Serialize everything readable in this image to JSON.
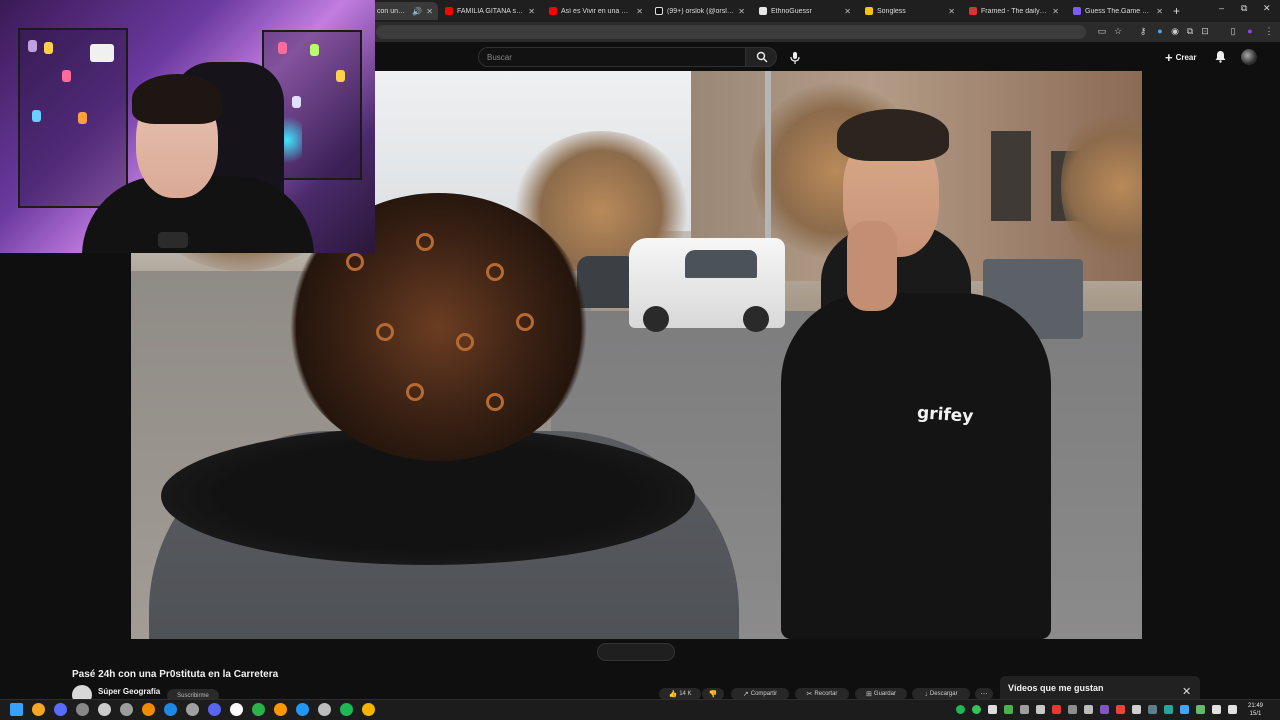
{
  "browser": {
    "tabs": [
      {
        "title": "con una Pr0",
        "color": "#c4302b",
        "active": true,
        "has_audio": true
      },
      {
        "title": "FAMILIA GITANA se enfre",
        "color": "#ff0000",
        "active": false
      },
      {
        "title": "Así es Vivir en una CASA",
        "color": "#ff0000",
        "active": false
      },
      {
        "title": "(99+) orslok (@orslokx) | T",
        "color": "#ffffff",
        "active": false
      },
      {
        "title": "EthnoGuessr",
        "color": "#e6e6e6",
        "active": false
      },
      {
        "title": "Songless",
        "color": "#f5c400",
        "active": false
      },
      {
        "title": "Framed - The daily movie",
        "color": "#d33",
        "active": false
      },
      {
        "title": "Guess The.Game #1342",
        "color": "#7a5cff",
        "active": false
      }
    ],
    "new_tab_glyph": "+",
    "window_controls": [
      "–",
      "⧉",
      "✕"
    ]
  },
  "youtube": {
    "search_placeholder": "Buscar",
    "create_label": "Crear",
    "video_title": "Pasé 24h con una Pr0stituta en la Carretera",
    "channel_name": "Súper Geografía",
    "subscribe_label": "Suscribirme",
    "actions": [
      {
        "label": "14 K",
        "icon": "like-icon"
      },
      {
        "label": "",
        "icon": "dislike-icon"
      },
      {
        "label": "Compartir",
        "icon": "share-icon"
      },
      {
        "label": "Recortar",
        "icon": "clip-icon"
      },
      {
        "label": "Guardar",
        "icon": "save-icon"
      },
      {
        "label": "Descargar",
        "icon": "download-icon"
      }
    ],
    "video_overlay_text": "grifey",
    "toast_text": "Vídeos que me gustan",
    "toast_close": "✕"
  },
  "taskbar": {
    "time": "21:49",
    "date": "15/1",
    "apps": [
      "windows-start",
      "search",
      "app-v",
      "app-settings",
      "app-arrow",
      "app-box",
      "app-file",
      "app-edge-like",
      "app-steam",
      "app-discord",
      "app-tiktok",
      "app-green",
      "app-cube",
      "app-refresh",
      "app-loop",
      "app-spotify",
      "app-chrome"
    ],
    "app_colors": [
      "#3aa0ff",
      "#f5a623",
      "#5a6cff",
      "#888888",
      "#cccccc",
      "#9c9c9c",
      "#f08c00",
      "#1e88e5",
      "#a0a0a0",
      "#5865f2",
      "#ffffff",
      "#29b34a",
      "#ff9800",
      "#2196f3",
      "#bdbdbd",
      "#1db954",
      "#f4b400"
    ]
  }
}
